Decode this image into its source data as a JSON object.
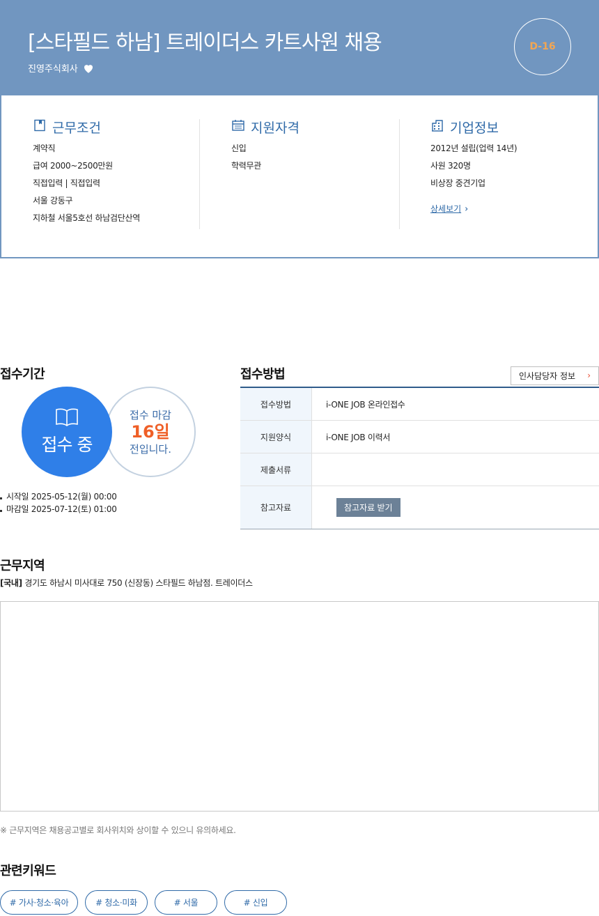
{
  "header": {
    "title": "[스타필드 하남] 트레이더스 카트사원 채용",
    "company": "진영주식회사",
    "dday": "D-16",
    "colors": {
      "background": "#7196c0",
      "dday_text": "#f2a653"
    }
  },
  "info": {
    "work": {
      "title": "근무조건",
      "icon": "bookmark-icon",
      "lines": [
        "계약직",
        "급여 2000~2500만원",
        "직접입력 | 직접입력",
        "서울 강동구",
        "지하철 서울5호선 하남검단산역"
      ]
    },
    "qual": {
      "title": "지원자격",
      "icon": "calendar-icon",
      "lines": [
        "신입",
        "학력무관"
      ]
    },
    "company": {
      "title": "기업정보",
      "icon": "building-icon",
      "lines": [
        "2012년 설립(업력 14년)",
        "사원 320명",
        "비상장 중견기업"
      ],
      "more": "상세보기"
    }
  },
  "period": {
    "title": "접수기간",
    "status": "접수 중",
    "deadline_label": "접수 마감",
    "days_left": "16일",
    "deadline_suffix": "전입니다.",
    "start": "시작일 2025-05-12(월) 00:00",
    "end": "마감일 2025-07-12(토) 01:00"
  },
  "apply": {
    "title": "접수방법",
    "hr_button": "인사담당자 정보",
    "rows": [
      {
        "label": "접수방법",
        "value": "i-ONE JOB 온라인접수"
      },
      {
        "label": "지원양식",
        "value": "i-ONE JOB 이력서"
      },
      {
        "label": "제출서류",
        "value": ""
      },
      {
        "label": "참고자료",
        "button": "참고자료 받기"
      }
    ]
  },
  "location": {
    "title": "근무지역",
    "tag": "[국내]",
    "address": "경기도 하남시 미사대로 750 (신장동) 스타필드 하남점. 트레이더스",
    "note": "※ 근무지역은 채용공고별로 회사위치와 상이할 수 있으니 유의하세요."
  },
  "keywords": {
    "title": "관련키워드",
    "items": [
      "# 가사·청소·육아",
      "# 청소·미화",
      "# 서울",
      "# 신입"
    ]
  }
}
